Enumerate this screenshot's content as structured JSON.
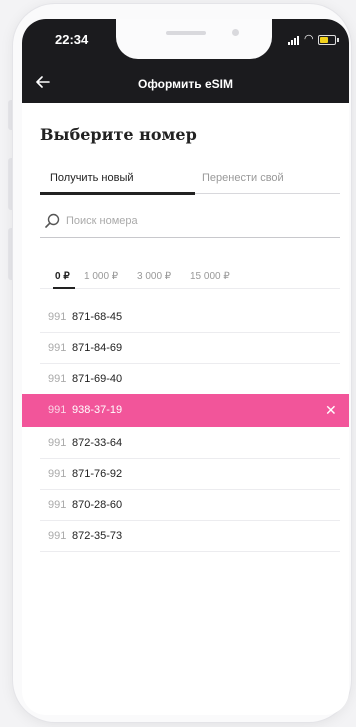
{
  "status_bar": {
    "time": "22:34"
  },
  "nav": {
    "back_icon": "arrow-left-icon",
    "title": "Оформить eSIM"
  },
  "page": {
    "heading": "Выберите номер"
  },
  "tabs": [
    {
      "label": "Получить новый",
      "active": true
    },
    {
      "label": "Перенести свой",
      "active": false
    }
  ],
  "search": {
    "placeholder": "Поиск номера",
    "icon": "search-icon"
  },
  "price_filters": [
    {
      "label": "0 ₽",
      "active": true
    },
    {
      "label": "1 000 ₽",
      "active": false
    },
    {
      "label": "3 000 ₽",
      "active": false
    },
    {
      "label": "15 000 ₽",
      "active": false
    }
  ],
  "numbers": [
    {
      "prefix": "991",
      "number": "871-68-45",
      "selected": false
    },
    {
      "prefix": "991",
      "number": "871-84-69",
      "selected": false
    },
    {
      "prefix": "991",
      "number": "871-69-40",
      "selected": false
    },
    {
      "prefix": "991",
      "number": "938-37-19",
      "selected": true
    },
    {
      "prefix": "991",
      "number": "872-33-64",
      "selected": false
    },
    {
      "prefix": "991",
      "number": "871-76-92",
      "selected": false
    },
    {
      "prefix": "991",
      "number": "870-28-60",
      "selected": false
    },
    {
      "prefix": "991",
      "number": "872-35-73",
      "selected": false
    }
  ],
  "colors": {
    "accent": "#f2559a",
    "topbar": "#1b1b1e",
    "battery": "#f3d21b"
  }
}
